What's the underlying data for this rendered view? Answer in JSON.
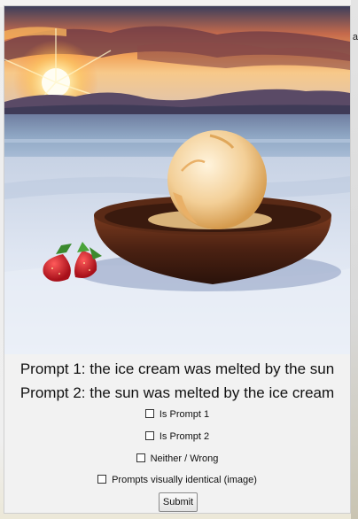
{
  "edge_text": "a",
  "image": {
    "alt": "A scoop of ice cream in a dark wooden bowl on snow, with a strawberry beside it and the sun setting over the sea"
  },
  "prompts": {
    "prompt1": "Prompt 1: the ice cream was melted by the sun",
    "prompt2": "Prompt 2: the sun was melted by the ice cream"
  },
  "options": [
    {
      "label": "Is Prompt 1",
      "checked": false
    },
    {
      "label": "Is Prompt 2",
      "checked": false
    },
    {
      "label": "Neither / Wrong",
      "checked": false
    },
    {
      "label": "Prompts visually identical (image)",
      "checked": false
    }
  ],
  "submit_label": "Submit"
}
